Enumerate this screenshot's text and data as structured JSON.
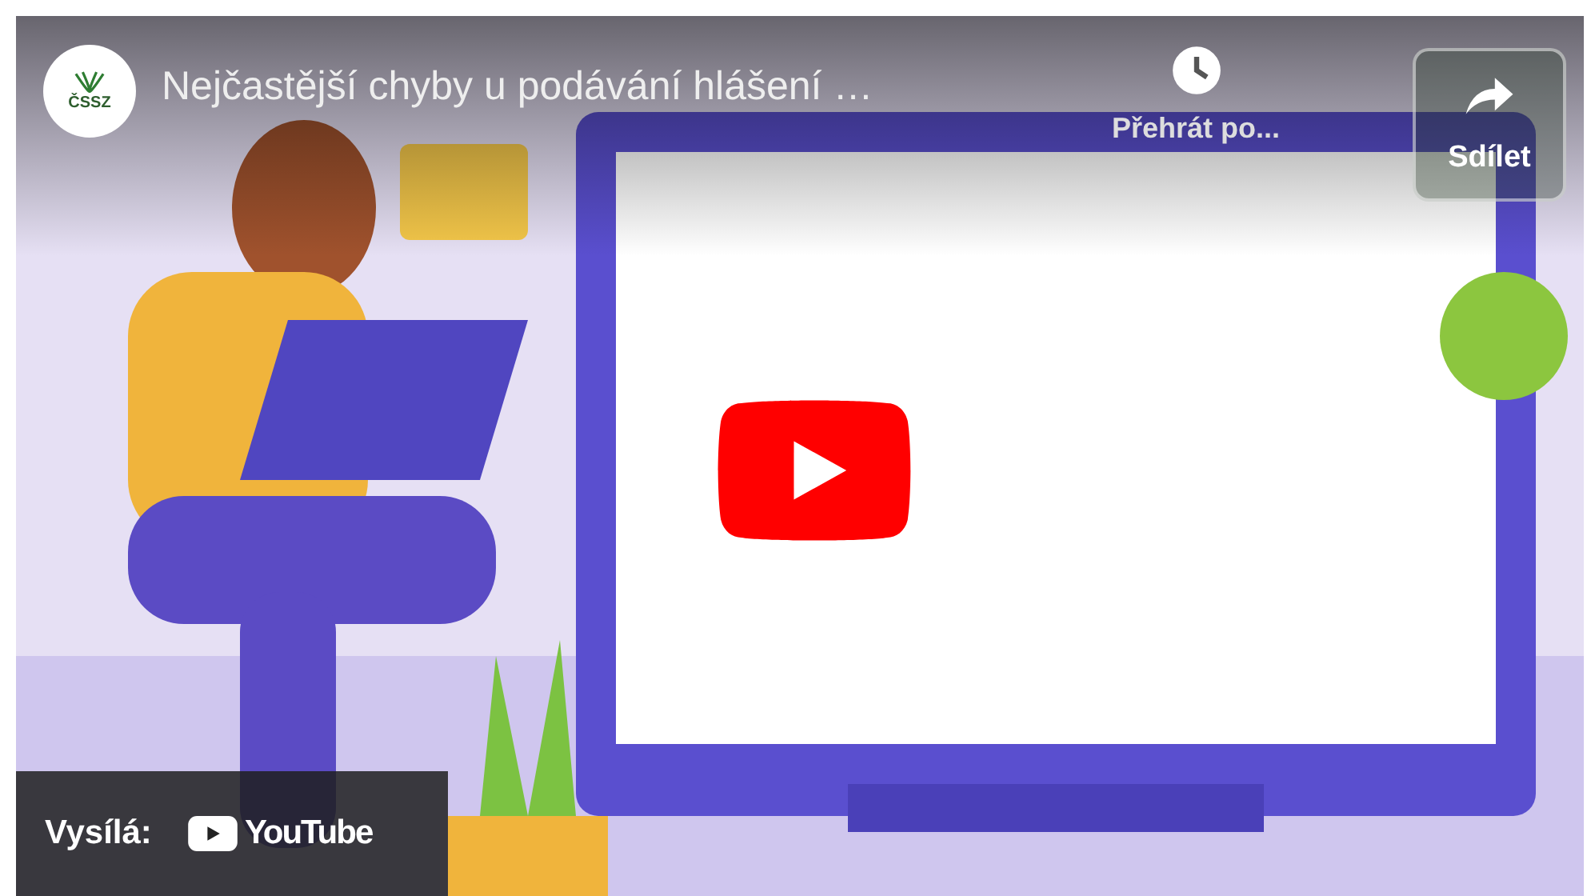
{
  "channel": {
    "logo_text": "ČSSZ"
  },
  "title": "Nejčastější chyby u podávání hlášení …",
  "watch_later": {
    "label": "Přehrát po..."
  },
  "share": {
    "label": "Sdílet"
  },
  "footer": {
    "label": "Vysílá:",
    "brand": "YouTube"
  }
}
